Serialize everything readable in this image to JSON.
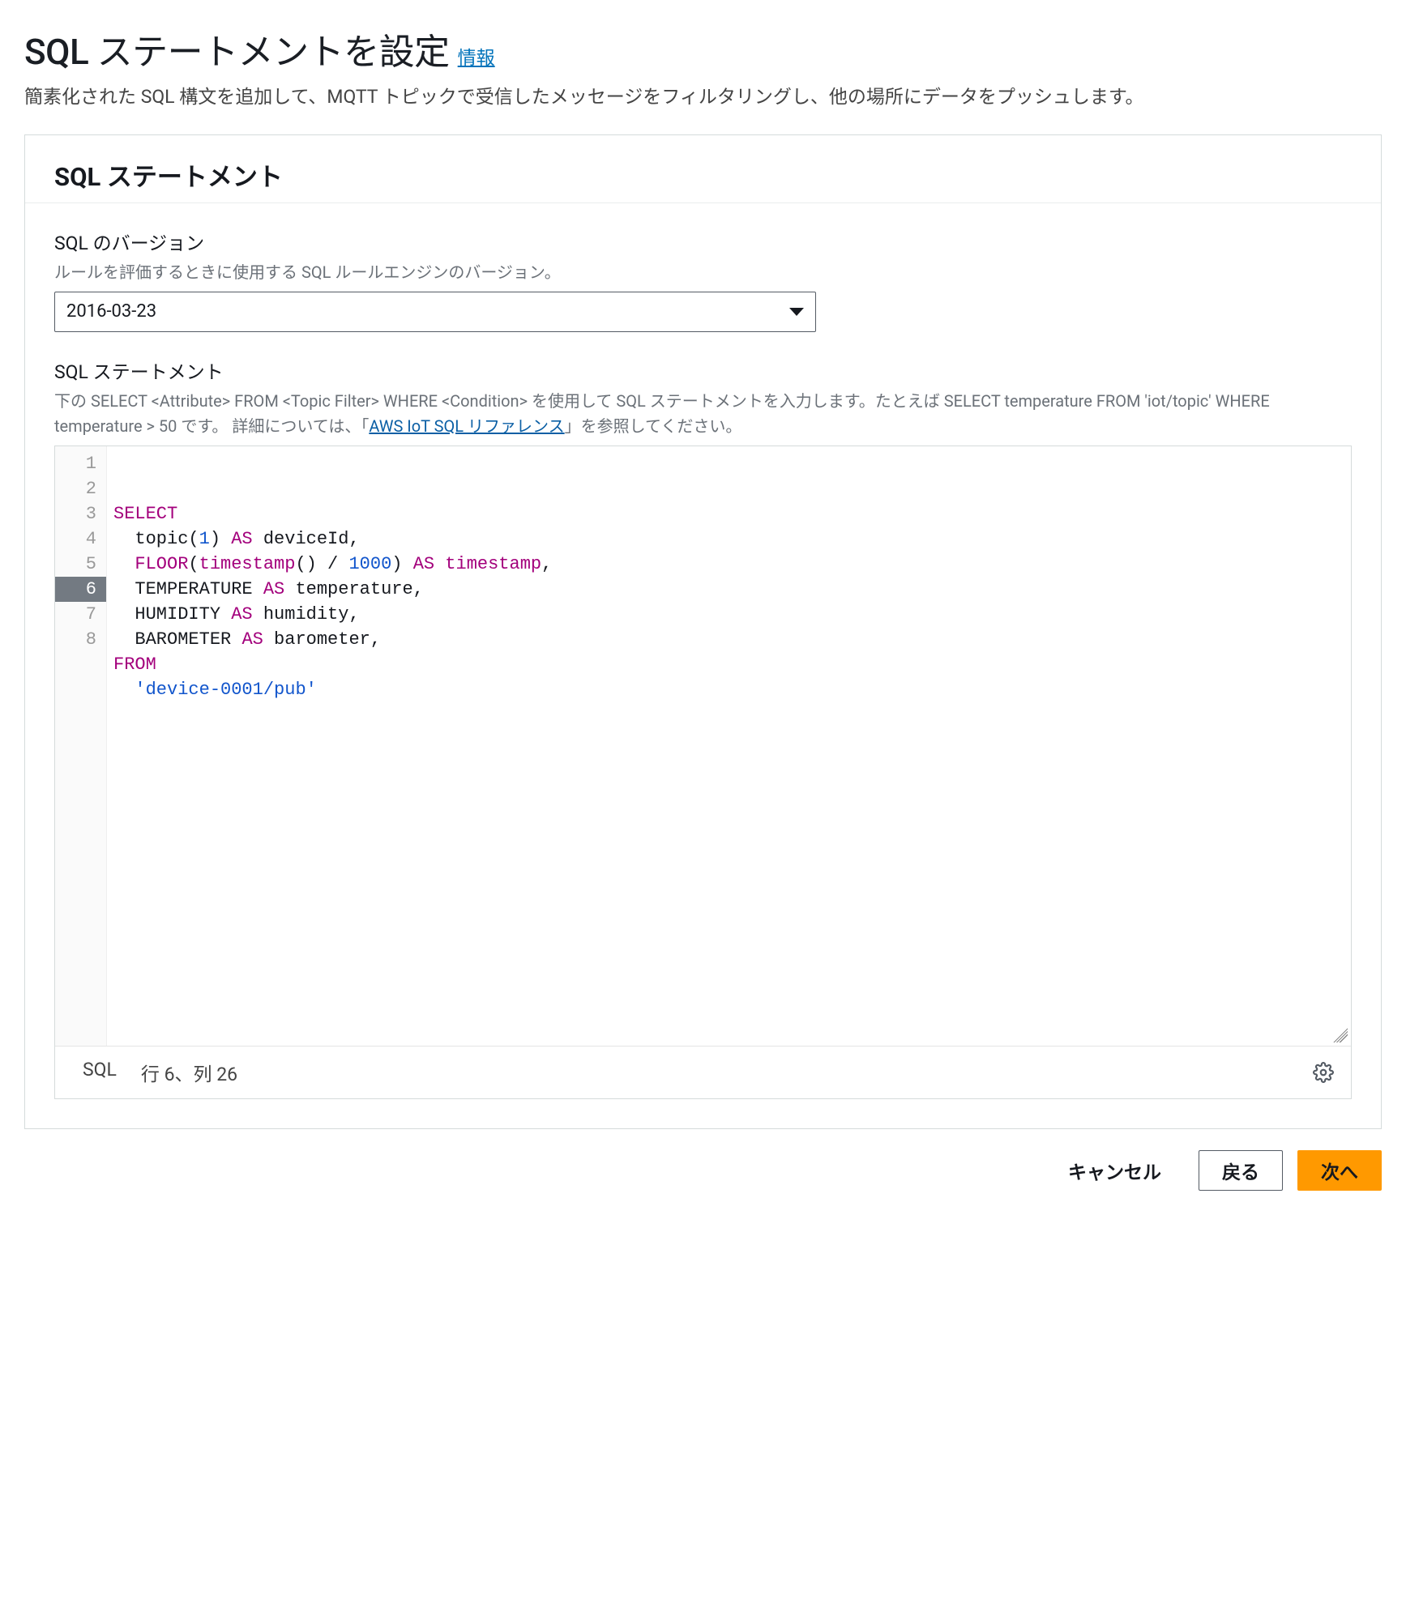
{
  "page": {
    "title": "SQL ステートメントを設定",
    "info_link": "情報",
    "subtitle": "簡素化された SQL 構文を追加して、MQTT トピックで受信したメッセージをフィルタリングし、他の場所にデータをプッシュします。"
  },
  "card": {
    "title": "SQL ステートメント"
  },
  "sql_version": {
    "label": "SQL のバージョン",
    "hint": "ルールを評価するときに使用する SQL ルールエンジンのバージョン。",
    "value": "2016-03-23"
  },
  "sql_statement": {
    "label": "SQL ステートメント",
    "hint_prefix": "下の SELECT <Attribute> FROM <Topic Filter> WHERE <Condition> を使用して SQL ステートメントを入力します。たとえば SELECT temperature FROM 'iot/topic' WHERE temperature > 50 です。 詳細については、「",
    "hint_link_text": "AWS IoT SQL リファレンス",
    "hint_suffix": "」を参照してください。",
    "code": {
      "lines": [
        [
          [
            "kw",
            "SELECT"
          ]
        ],
        [
          [
            "pl",
            "  topic("
          ],
          [
            "num",
            "1"
          ],
          [
            "pl",
            ") "
          ],
          [
            "kw",
            "AS"
          ],
          [
            "pl",
            " deviceId,"
          ]
        ],
        [
          [
            "pl",
            "  "
          ],
          [
            "fn",
            "FLOOR"
          ],
          [
            "pl",
            "("
          ],
          [
            "fn",
            "timestamp"
          ],
          [
            "pl",
            "() / "
          ],
          [
            "num",
            "1000"
          ],
          [
            "pl",
            ") "
          ],
          [
            "kw",
            "AS"
          ],
          [
            "pl",
            " "
          ],
          [
            "fn",
            "timestamp"
          ],
          [
            "pl",
            ","
          ]
        ],
        [
          [
            "pl",
            "  TEMPERATURE "
          ],
          [
            "kw",
            "AS"
          ],
          [
            "pl",
            " temperature,"
          ]
        ],
        [
          [
            "pl",
            "  HUMIDITY "
          ],
          [
            "kw",
            "AS"
          ],
          [
            "pl",
            " humidity,"
          ]
        ],
        [
          [
            "pl",
            "  BAROMETER "
          ],
          [
            "kw",
            "AS"
          ],
          [
            "pl",
            " barometer,"
          ]
        ],
        [
          [
            "kw",
            "FROM"
          ]
        ],
        [
          [
            "pl",
            "  "
          ],
          [
            "str",
            "'device-0001/pub'"
          ]
        ]
      ],
      "active_line": 6
    },
    "status": {
      "lang": "SQL",
      "position": "行 6、列 26"
    }
  },
  "actions": {
    "cancel": "キャンセル",
    "back": "戻る",
    "next": "次へ"
  }
}
